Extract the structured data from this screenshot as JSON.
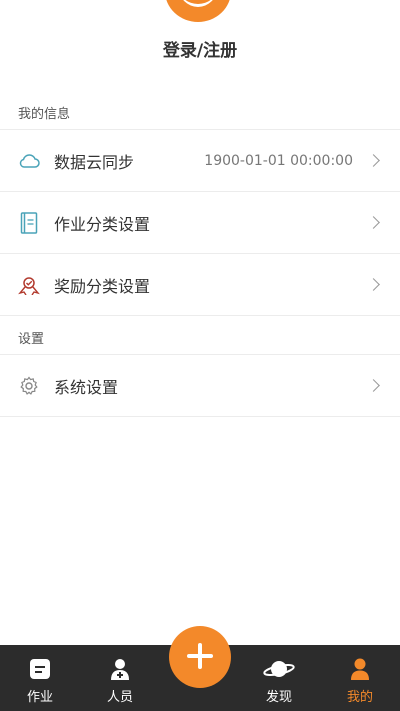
{
  "header": {
    "login_label": "登录/注册"
  },
  "sections": {
    "info_title": "我的信息",
    "settings_title": "设置"
  },
  "rows": {
    "sync": {
      "label": "数据云同步",
      "value": "1900-01-01 00:00:00"
    },
    "homework_category": {
      "label": "作业分类设置"
    },
    "reward_category": {
      "label": "奖励分类设置"
    },
    "system": {
      "label": "系统设置"
    }
  },
  "tabbar": {
    "homework": "作业",
    "people": "人员",
    "discover": "发现",
    "mine": "我的"
  },
  "colors": {
    "accent": "#f3892a",
    "tabbar_bg": "#2c2c2c",
    "cloud_icon": "#4aa3b8",
    "reward_icon": "#b23a2e"
  },
  "icons": {
    "sync": "cloud-icon",
    "homework_category": "notebook-icon",
    "reward_category": "ribbon-icon",
    "system": "gear-icon",
    "fab": "plus-icon"
  }
}
